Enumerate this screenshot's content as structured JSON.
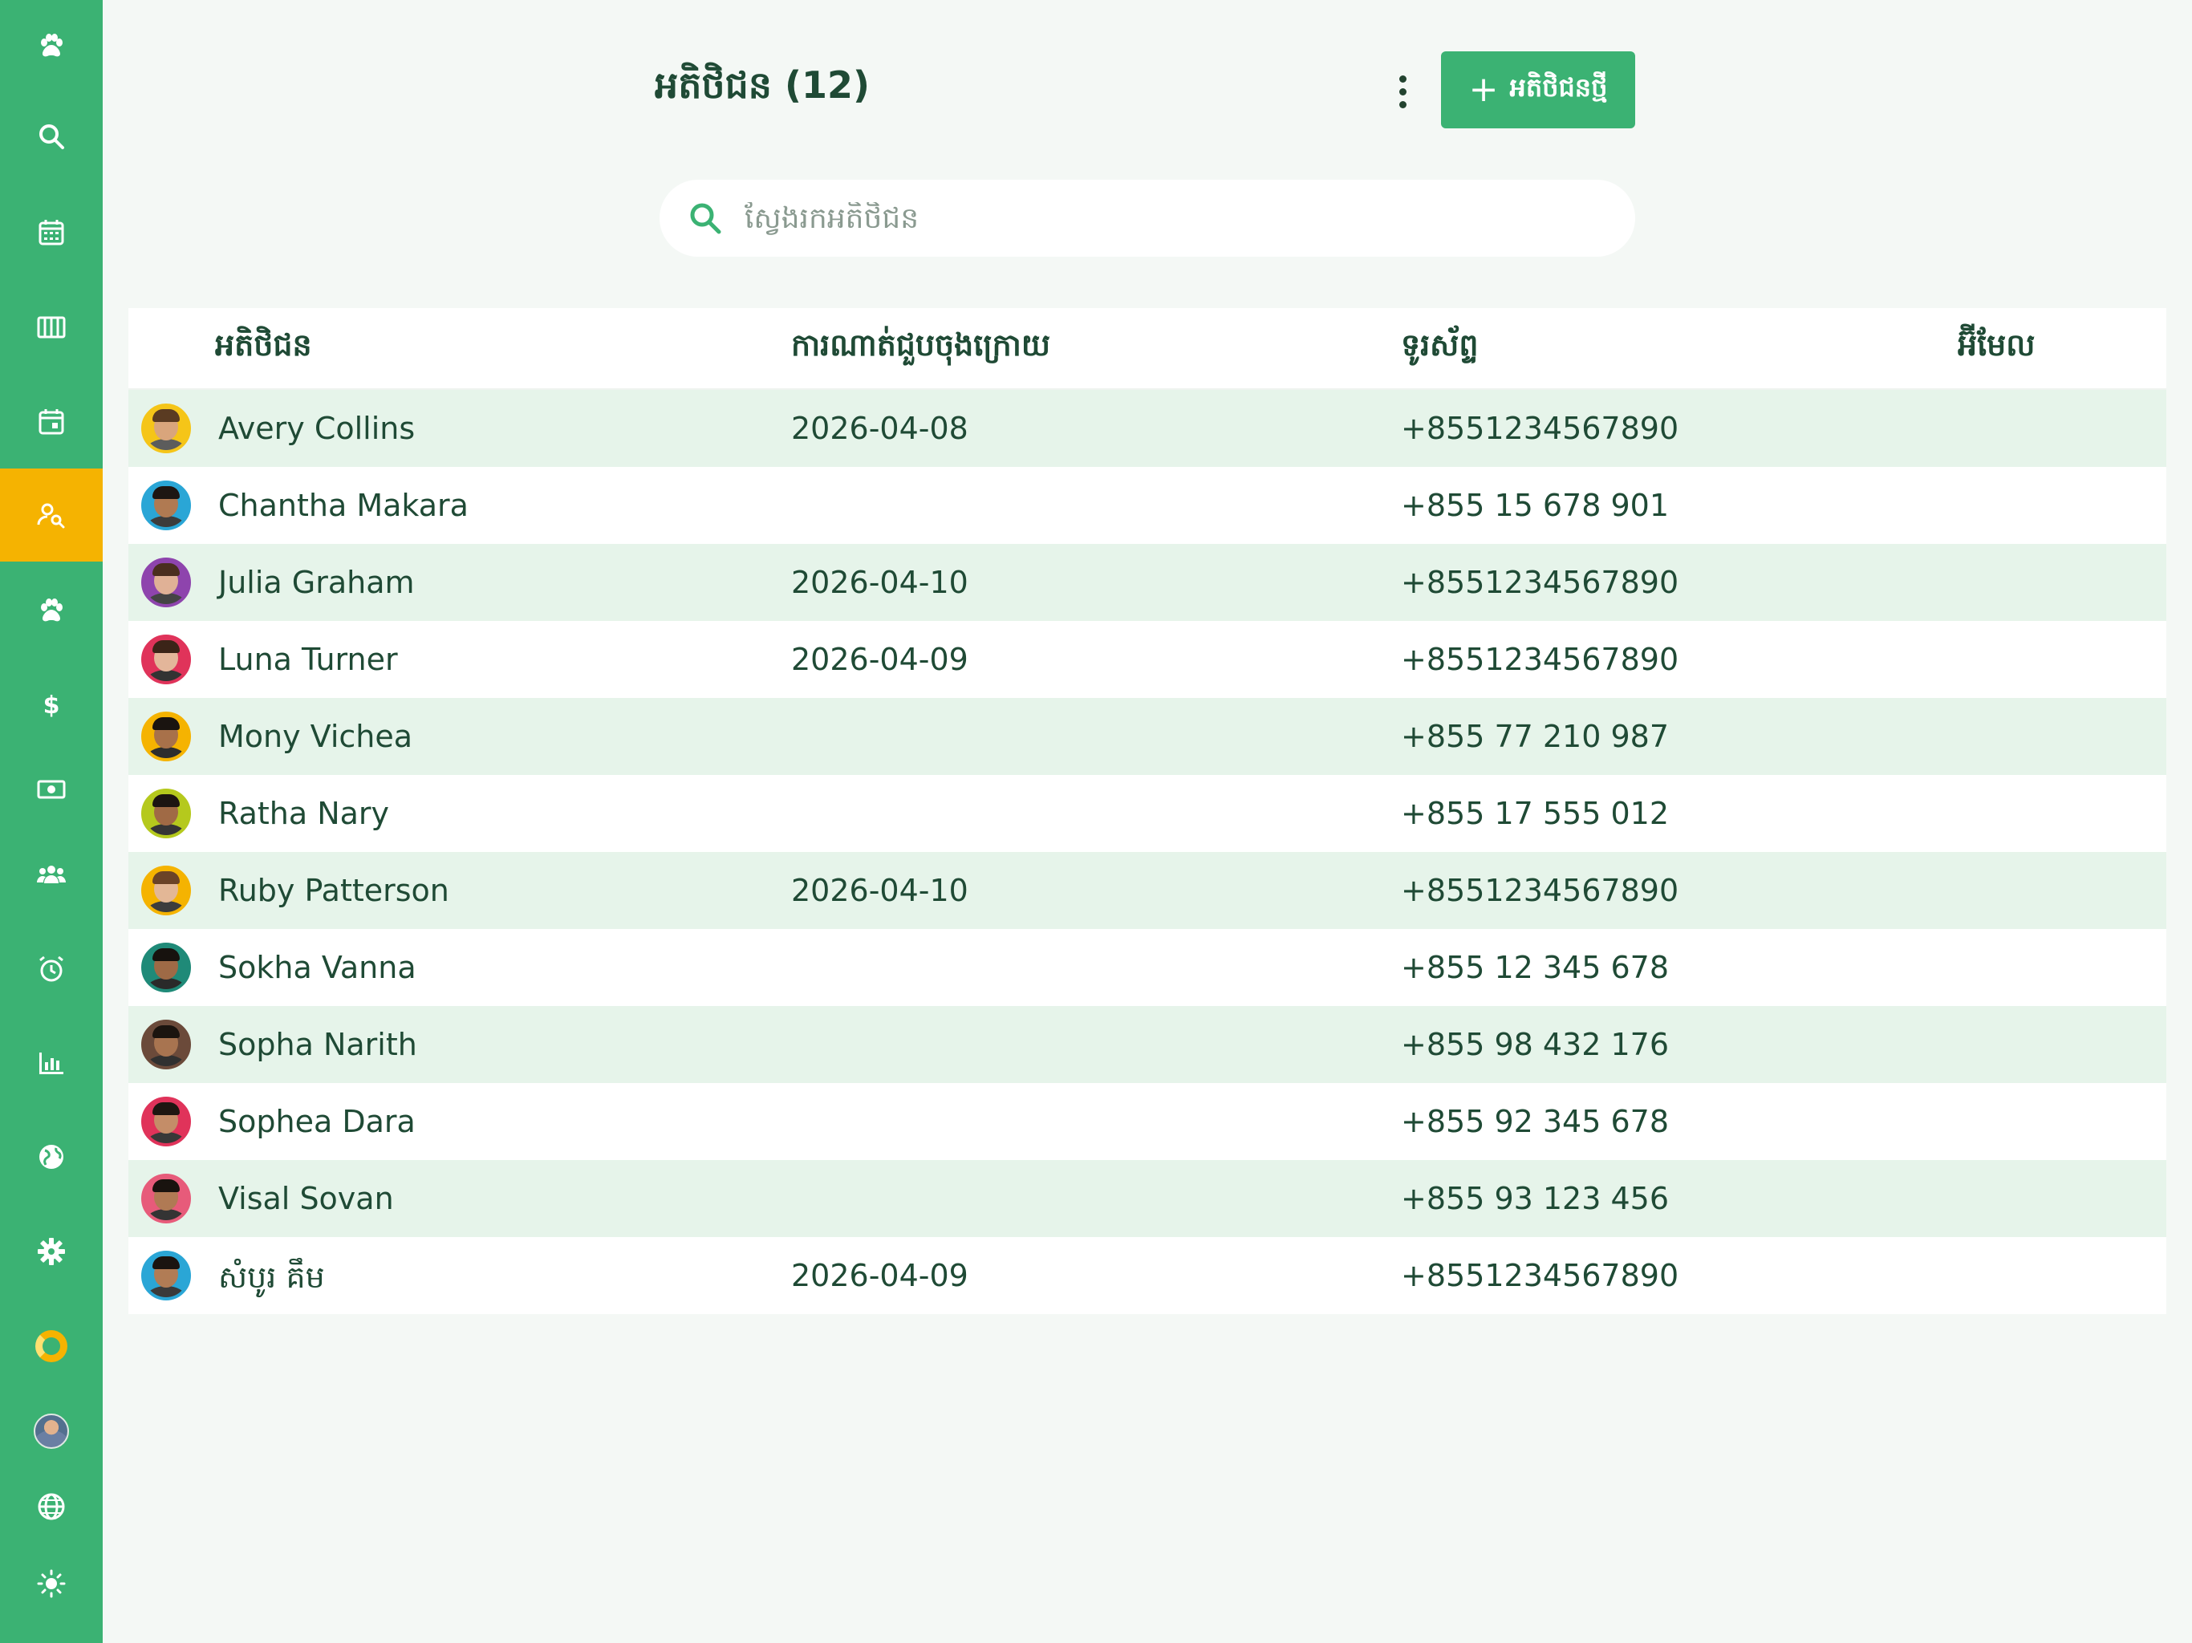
{
  "header": {
    "title": "អតិថិជន (12)",
    "add_button_label": "អតិថិជនថ្មី",
    "add_button_plus": "+"
  },
  "search": {
    "placeholder": "ស្វែងរកអតិថិជន",
    "value": ""
  },
  "table": {
    "columns": [
      "អតិថិជន",
      "ការណាត់ជួបចុងក្រោយ",
      "ទូរស័ព្ទ",
      "អ៊ីមែល"
    ],
    "rows": [
      {
        "name": "Avery Collins",
        "last_appointment": "2026-04-08",
        "phone": "+8551234567890",
        "email": "",
        "avatar_ring": "#f5c518",
        "skin": "#d9a57c",
        "hair": "#5a3b22",
        "shirt": "#5c5c5c"
      },
      {
        "name": "Chantha Makara",
        "last_appointment": "",
        "phone": "+855 15 678 901",
        "email": "",
        "avatar_ring": "#2aa6d6",
        "skin": "#b07a52",
        "hair": "#1d1612",
        "shirt": "#3c3c3c"
      },
      {
        "name": "Julia Graham",
        "last_appointment": "2026-04-10",
        "phone": "+8551234567890",
        "email": "",
        "avatar_ring": "#8e44ad",
        "skin": "#e0b196",
        "hair": "#4a2e1f",
        "shirt": "#444444"
      },
      {
        "name": "Luna Turner",
        "last_appointment": "2026-04-09",
        "phone": "+8551234567890",
        "email": "",
        "avatar_ring": "#e0335a",
        "skin": "#e3b69a",
        "hair": "#3b2418",
        "shirt": "#333333"
      },
      {
        "name": "Mony Vichea",
        "last_appointment": "",
        "phone": "+855 77 210 987",
        "email": "",
        "avatar_ring": "#f5b301",
        "skin": "#a8714a",
        "hair": "#1a1410",
        "shirt": "#2d2d2d"
      },
      {
        "name": "Ratha Nary",
        "last_appointment": "",
        "phone": "+855 17 555 012",
        "email": "",
        "avatar_ring": "#b5c91d",
        "skin": "#a06a45",
        "hair": "#1c1511",
        "shirt": "#353535"
      },
      {
        "name": "Ruby Patterson",
        "last_appointment": "2026-04-10",
        "phone": "+8551234567890",
        "email": "",
        "avatar_ring": "#f5b301",
        "skin": "#e3b796",
        "hair": "#6b4327",
        "shirt": "#3d3d3d"
      },
      {
        "name": "Sokha Vanna",
        "last_appointment": "",
        "phone": "+855 12 345 678",
        "email": "",
        "avatar_ring": "#1f8a78",
        "skin": "#9e6a46",
        "hair": "#17120e",
        "shirt": "#2a2a2a"
      },
      {
        "name": "Sopha Narith",
        "last_appointment": "",
        "phone": "+855 98 432 176",
        "email": "",
        "avatar_ring": "#6b4a3a",
        "skin": "#a87450",
        "hair": "#1b140f",
        "shirt": "#303030"
      },
      {
        "name": "Sophea Dara",
        "last_appointment": "",
        "phone": "+855 92 345 678",
        "email": "",
        "avatar_ring": "#e0335a",
        "skin": "#c48d68",
        "hair": "#1e1611",
        "shirt": "#383838"
      },
      {
        "name": "Visal Sovan",
        "last_appointment": "",
        "phone": "+855 93 123 456",
        "email": "",
        "avatar_ring": "#e75b7a",
        "skin": "#b07a54",
        "hair": "#19130f",
        "shirt": "#343434"
      },
      {
        "name": "សំបូរ គឹម",
        "last_appointment": "2026-04-09",
        "phone": "+8551234567890",
        "email": "",
        "avatar_ring": "#2aa6d6",
        "skin": "#b17c55",
        "hair": "#1a1410",
        "shirt": "#3a3a3a"
      }
    ]
  },
  "sidebar": {
    "items": [
      {
        "icon": "paw-icon",
        "active": false
      },
      {
        "icon": "search-icon",
        "active": false
      },
      {
        "icon": "calendar-grid-icon",
        "active": false
      },
      {
        "icon": "board-columns-icon",
        "active": false
      },
      {
        "icon": "calendar-day-icon",
        "active": false
      },
      {
        "icon": "customer-search-icon",
        "active": true
      },
      {
        "icon": "paw-icon",
        "active": false
      },
      {
        "icon": "dollar-icon",
        "active": false
      },
      {
        "icon": "cash-icon",
        "active": false
      },
      {
        "icon": "group-icon",
        "active": false
      },
      {
        "icon": "alarm-icon",
        "active": false
      },
      {
        "icon": "bar-chart-icon",
        "active": false
      },
      {
        "icon": "globe-filled-icon",
        "active": false
      },
      {
        "icon": "gear-icon",
        "active": false
      },
      {
        "icon": "donut-icon",
        "active": false
      },
      {
        "icon": "user-avatar",
        "active": false
      },
      {
        "icon": "language-globe-icon",
        "active": false
      },
      {
        "icon": "sun-icon",
        "active": false
      }
    ]
  },
  "colors": {
    "sidebar": "#3bb273",
    "active": "#f5b301",
    "row_alt": "#e6f4ea",
    "text": "#1f4a35"
  }
}
